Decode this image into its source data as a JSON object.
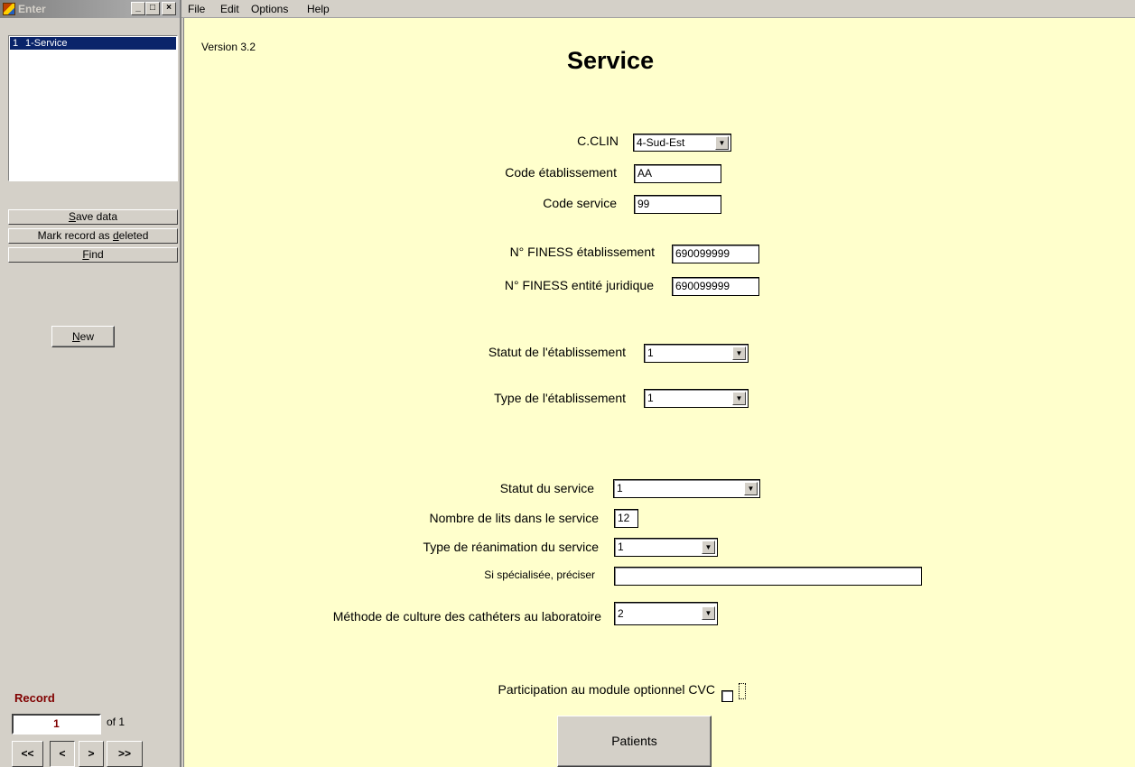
{
  "window": {
    "title": "Enter",
    "min_label": "_",
    "max_label": "□",
    "close_label": "×"
  },
  "menu": {
    "file": "File",
    "edit": "Edit",
    "options": "Options",
    "help": "Help"
  },
  "record_list": {
    "rows": [
      {
        "num": "1",
        "label": "1-Service"
      }
    ]
  },
  "side_buttons": {
    "save_pre": "",
    "save_key": "S",
    "save_post": "ave data",
    "mark_pre": "Mark record as ",
    "mark_key": "d",
    "mark_post": "eleted",
    "find_pre": "",
    "find_key": "F",
    "find_post": "ind",
    "new_pre": "",
    "new_key": "N",
    "new_post": "ew"
  },
  "record_nav": {
    "label": "Record",
    "current": "1",
    "of_text": "of 1",
    "first": "<<",
    "prev": "<",
    "next": ">",
    "last": ">>"
  },
  "form": {
    "version": "Version 3.2",
    "title": "Service",
    "cclin": {
      "label": "C.CLIN",
      "value": "4-Sud-Est"
    },
    "code_etab": {
      "label": "Code établissement",
      "value": "AA"
    },
    "code_service": {
      "label": "Code service",
      "value": "99"
    },
    "finess_etab": {
      "label": "N° FINESS établissement",
      "value": "690099999"
    },
    "finess_juridique": {
      "label": "N° FINESS entité juridique",
      "value": "690099999"
    },
    "statut_etab": {
      "label": "Statut de l'établissement",
      "value": "1"
    },
    "type_etab": {
      "label": "Type de l'établissement",
      "value": "1"
    },
    "statut_service": {
      "label": "Statut du service",
      "value": "1"
    },
    "nb_lits": {
      "label": "Nombre de lits dans le service",
      "value": "12"
    },
    "type_reanimation": {
      "label": "Type de réanimation du service",
      "value": "1"
    },
    "specialisee": {
      "label": "Si spécialisée, préciser",
      "value": ""
    },
    "methode_culture": {
      "label": "Méthode de culture des cathéters au laboratoire",
      "value": "2"
    },
    "cvc": {
      "label": "Participation au module optionnel CVC",
      "checked": false
    },
    "patients_button": "Patients",
    "dropdown_arrow": "▼"
  }
}
